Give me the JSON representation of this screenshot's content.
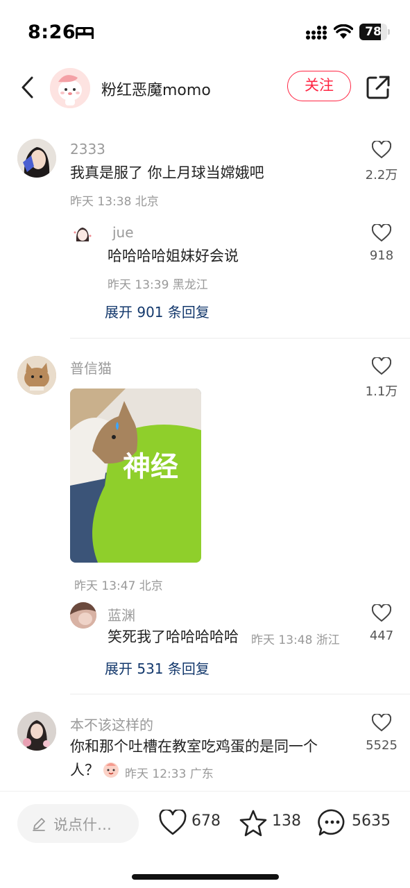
{
  "status_bar": {
    "time": "8:26",
    "battery": "78",
    "battery_level": 0.78
  },
  "header": {
    "author_name": "粉红恶魔momo",
    "follow_label": "关注"
  },
  "comments": [
    {
      "user": "2333",
      "text": "我真是服了 你上月球当嫦娥吧",
      "meta": "昨天 13:38 北京",
      "likes": "2.2万",
      "reply": {
        "user": "jue",
        "text": "哈哈哈哈姐妹好会说",
        "meta": "昨天 13:39 黑龙江",
        "likes": "918"
      },
      "expand": "展开 901 条回复"
    },
    {
      "user": "普信猫",
      "sticker_text": "神经",
      "meta": "昨天 13:47 北京",
      "likes": "1.1万",
      "reply": {
        "user": "蓝渊",
        "text": "笑死我了哈哈哈哈哈",
        "meta": "昨天 13:48 浙江",
        "likes": "447"
      },
      "expand": "展开 531 条回复"
    },
    {
      "user": "本不该这样的",
      "text_line1": "你和那个吐槽在教室吃鸡蛋的是同一个",
      "text_line2": "人？",
      "meta": "昨天 12:33 广东",
      "likes": "5525"
    }
  ],
  "bottom_bar": {
    "input_placeholder": "说点什…",
    "likes": "678",
    "favorites": "138",
    "comments": "5635"
  },
  "colors": {
    "accent": "#ff2442",
    "link": "#13386c",
    "muted": "#999999"
  }
}
